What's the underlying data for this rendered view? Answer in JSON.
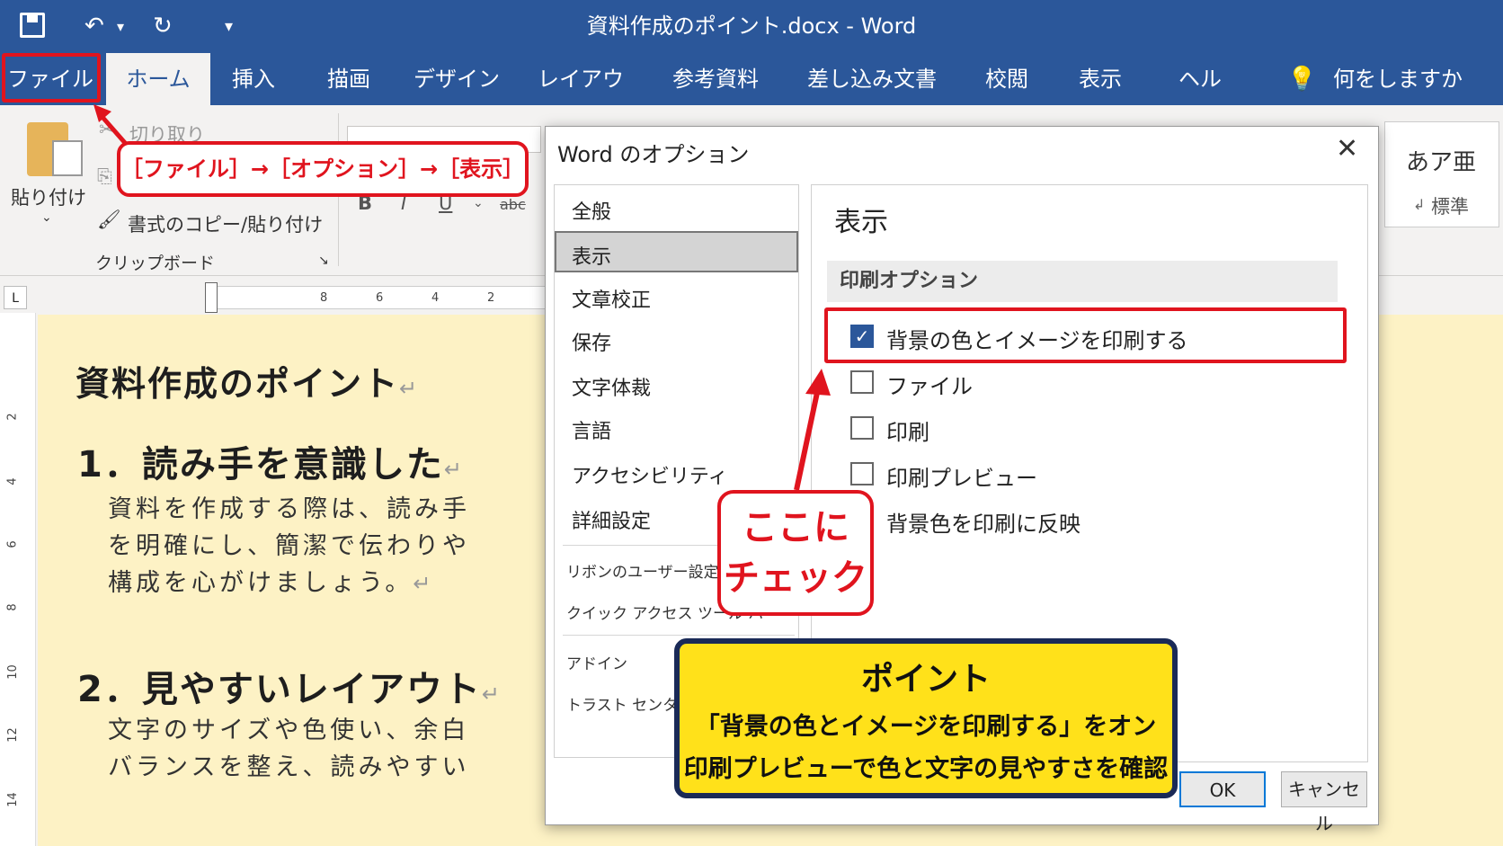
{
  "titlebar": {
    "title": "資料作成のポイント.docx  -  Word",
    "undo": "↶",
    "redo": "↻",
    "customize": "⌄"
  },
  "tabs": [
    "ファイル",
    "ホーム",
    "挿入",
    "描画",
    "デザイン",
    "レイアウト",
    "参考資料",
    "差し込み文書",
    "校閲",
    "表示",
    "ヘルプ"
  ],
  "tell_me": "何をしますか",
  "ribbon": {
    "paste": "貼り付け",
    "cut": "切り取り",
    "format_painter": "書式のコピー/貼り付け",
    "group_clipboard": "クリップボード",
    "bold": "B",
    "italic": "I",
    "underline": "U",
    "strike": "abc",
    "style_preview": "あア亜",
    "style_name": "標準"
  },
  "ruler": {
    "h_ticks": [
      "8",
      "6",
      "4",
      "2"
    ],
    "v_ticks": [
      "2",
      "4",
      "6",
      "8",
      "10",
      "12",
      "14"
    ]
  },
  "callout_top": "［ファイル］→［オプション］→［表示］",
  "document": {
    "title": "資料作成のポイント",
    "h1": "1．読み手を意識した",
    "p1": [
      "資料を作成する際は、読み手",
      "を明確にし、簡潔で伝わりや",
      "構成を心がけましょう。"
    ],
    "h2": "2．見やすいレイアウト",
    "p2": [
      "文字のサイズや色使い、余白",
      "バランスを整え、読みやすい"
    ],
    "return_mark": "↵"
  },
  "dialog": {
    "title": "Word のオプション",
    "close": "✕",
    "nav": [
      "全般",
      "表示",
      "文章校正",
      "保存",
      "文字体裁",
      "言語",
      "アクセシビリティ",
      "詳細設定"
    ],
    "nav_small": [
      "リボンのユーザー設定",
      "クイック アクセス ツール バー",
      "アドイン",
      "トラスト センター"
    ],
    "section_title": "表示",
    "print_options_heading": "印刷オプション",
    "options": [
      {
        "label": "背景の色とイメージを印刷する",
        "checked": true
      },
      {
        "label": "ファイル",
        "checked": false
      },
      {
        "label": "印刷",
        "checked": false
      },
      {
        "label": "印刷プレビュー",
        "checked": false
      },
      {
        "label": "背景色を印刷に反映",
        "checked": false
      }
    ],
    "ok": "OK",
    "cancel": "キャンセル"
  },
  "callout_check": [
    "ここに",
    "チェック"
  ],
  "point": {
    "title": "ポイント",
    "line1": "「背景の色とイメージを印刷する」をオン",
    "line2": "印刷プレビューで色と文字の見やすさを確認"
  },
  "colors": {
    "word_blue": "#2b579a",
    "highlight_red": "#e0141e",
    "point_yellow": "#ffe11a",
    "doc_bg": "#fdf2c5"
  }
}
